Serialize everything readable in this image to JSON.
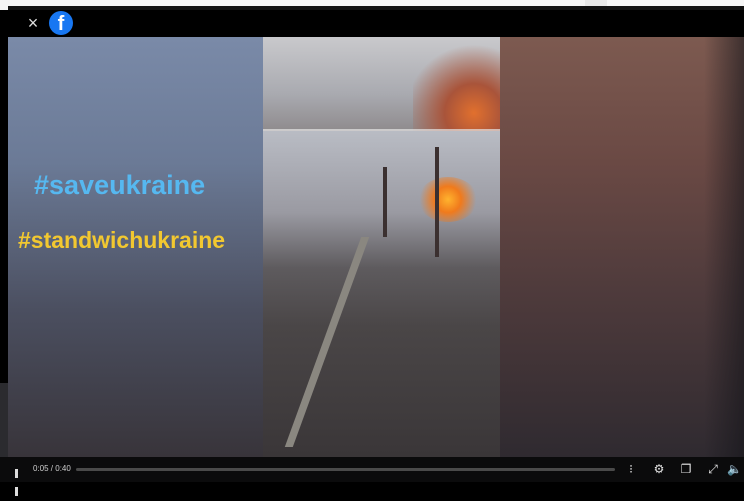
{
  "header": {
    "close_icon": "×",
    "logo_letter": "f"
  },
  "video": {
    "hashtag_1": "#saveukraine",
    "hashtag_2": "#standwichukraine"
  },
  "controls": {
    "time": "0:05 / 0:40",
    "progress_fraction": 0.0,
    "icons": {
      "captions": "⁝",
      "settings": "⚙",
      "pip": "❐",
      "fullscreen": "⤢",
      "volume": "🔈"
    }
  },
  "colors": {
    "facebook_blue": "#1877f2",
    "hashtag_blue": "#56b8f0",
    "hashtag_yellow": "#f2c830"
  }
}
